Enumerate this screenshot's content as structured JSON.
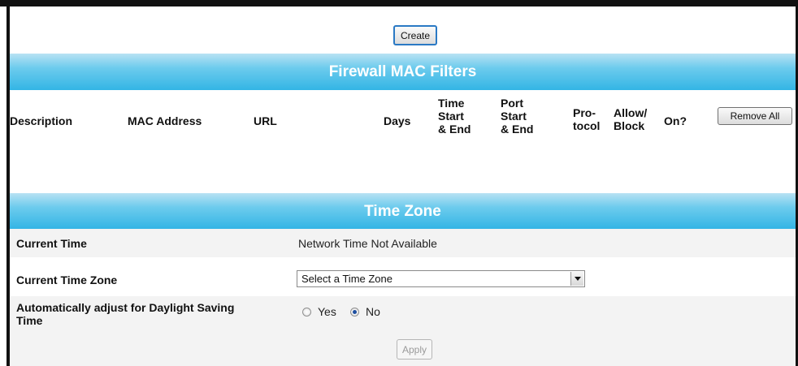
{
  "create_button": "Create",
  "firewall": {
    "title": "Firewall MAC Filters",
    "columns": {
      "description": "Description",
      "mac": "MAC Address",
      "url": "URL",
      "days": "Days",
      "time_1": "Time",
      "time_2": "Start",
      "time_3": "& End",
      "port_1": "Port",
      "port_2": "Start",
      "port_3": "& End",
      "proto_1": "Pro-",
      "proto_2": "tocol",
      "allow_1": "Allow/",
      "allow_2": "Block",
      "on": "On?"
    },
    "remove_all": "Remove All"
  },
  "timezone": {
    "title": "Time Zone",
    "current_time_label": "Current Time",
    "current_time_value": "Network Time Not Available",
    "zone_label": "Current Time Zone",
    "zone_selected": "Select a Time Zone",
    "dst_label_1": "Automatically adjust for Daylight Saving",
    "dst_label_2": "Time",
    "dst_yes": "Yes",
    "dst_no": "No",
    "dst_value": "No",
    "apply": "Apply"
  },
  "colors": {
    "header_bar": "#33b5e5",
    "row_alt": "#f3f3f3"
  }
}
